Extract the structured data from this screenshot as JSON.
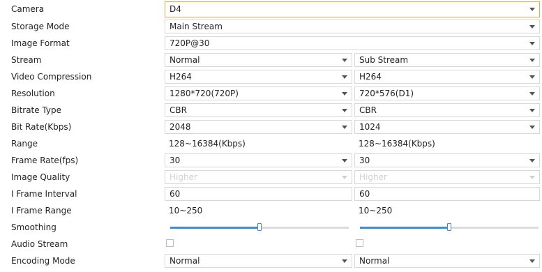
{
  "rows": {
    "camera": {
      "label": "Camera",
      "value": "D4"
    },
    "storage_mode": {
      "label": "Storage Mode",
      "value": "Main Stream"
    },
    "image_format": {
      "label": "Image Format",
      "value": "720P@30"
    },
    "stream": {
      "label": "Stream",
      "main": "Normal",
      "sub": "Sub Stream"
    },
    "video_compression": {
      "label": "Video Compression",
      "main": "H264",
      "sub": "H264"
    },
    "resolution": {
      "label": "Resolution",
      "main": "1280*720(720P)",
      "sub": "720*576(D1)"
    },
    "bitrate_type": {
      "label": "Bitrate Type",
      "main": "CBR",
      "sub": "CBR"
    },
    "bit_rate": {
      "label": "Bit Rate(Kbps)",
      "main": "2048",
      "sub": "1024"
    },
    "range": {
      "label": "Range",
      "main": "128~16384(Kbps)",
      "sub": "128~16384(Kbps)"
    },
    "frame_rate": {
      "label": "Frame Rate(fps)",
      "main": "30",
      "sub": "30"
    },
    "image_quality": {
      "label": "Image Quality",
      "main": "Higher",
      "sub": "Higher"
    },
    "i_frame_interval": {
      "label": "I Frame Interval",
      "main": "60",
      "sub": "60"
    },
    "i_frame_range": {
      "label": "I Frame Range",
      "main": "10~250",
      "sub": "10~250"
    },
    "smoothing": {
      "label": "Smoothing",
      "main_level": 0.5,
      "sub_level": 0.5
    },
    "audio_stream": {
      "label": "Audio Stream",
      "main_checked": false,
      "sub_checked": false
    },
    "encoding_mode": {
      "label": "Encoding Mode",
      "main": "Normal",
      "sub": "Normal"
    }
  },
  "colors": {
    "accent": "#3b8fd9",
    "focus_border": "#f0a540"
  }
}
